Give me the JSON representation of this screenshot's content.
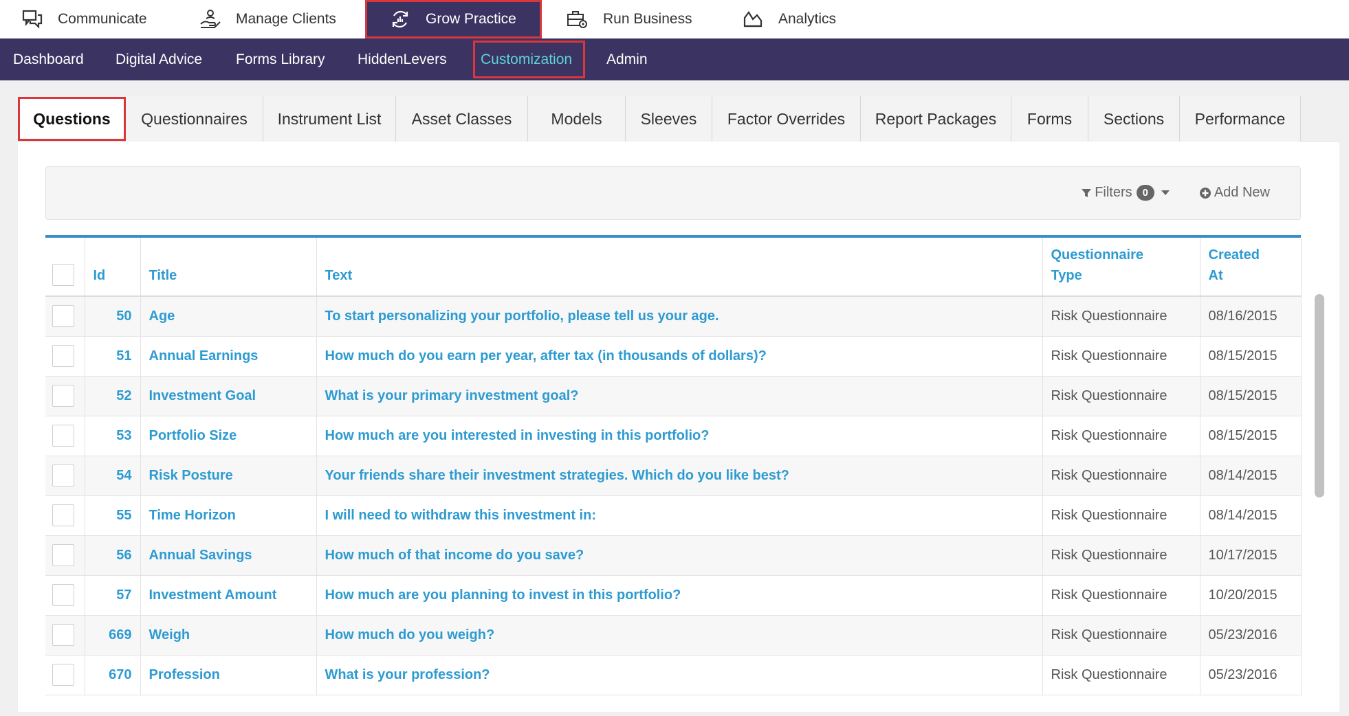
{
  "top_nav": [
    {
      "label": "Communicate",
      "icon": "chat-icon"
    },
    {
      "label": "Manage Clients",
      "icon": "hand-coins-icon"
    },
    {
      "label": "Grow Practice",
      "icon": "growth-cycle-icon",
      "active": true
    },
    {
      "label": "Run Business",
      "icon": "briefcase-gear-icon"
    },
    {
      "label": "Analytics",
      "icon": "area-chart-icon"
    }
  ],
  "sub_nav": [
    {
      "label": "Dashboard"
    },
    {
      "label": "Digital Advice"
    },
    {
      "label": "Forms Library"
    },
    {
      "label": "HiddenLevers"
    },
    {
      "label": "Customization",
      "active": true
    },
    {
      "label": "Admin"
    }
  ],
  "tabs": [
    {
      "label": "Questions",
      "active": true
    },
    {
      "label": "Questionnaires"
    },
    {
      "label": "Instrument List"
    },
    {
      "label": "Asset Classes"
    },
    {
      "label": "Models"
    },
    {
      "label": "Sleeves"
    },
    {
      "label": "Factor Overrides"
    },
    {
      "label": "Report Packages"
    },
    {
      "label": "Forms"
    },
    {
      "label": "Sections"
    },
    {
      "label": "Performance"
    }
  ],
  "toolbar": {
    "filters_label": "Filters",
    "filters_count": "0",
    "add_new_label": "Add New"
  },
  "table": {
    "columns": {
      "id": "Id",
      "title": "Title",
      "text": "Text",
      "qtype_line1": "Questionnaire",
      "qtype_line2": "Type",
      "created_line1": "Created",
      "created_line2": "At"
    },
    "rows": [
      {
        "id": "50",
        "title": "Age",
        "text": "To start personalizing your portfolio, please tell us your age.",
        "qtype": "Risk Questionnaire",
        "created": "08/16/2015"
      },
      {
        "id": "51",
        "title": "Annual Earnings",
        "text": "How much do you earn per year, after tax (in thousands of dollars)?",
        "qtype": "Risk Questionnaire",
        "created": "08/15/2015"
      },
      {
        "id": "52",
        "title": "Investment Goal",
        "text": "What is your primary investment goal?",
        "qtype": "Risk Questionnaire",
        "created": "08/15/2015"
      },
      {
        "id": "53",
        "title": "Portfolio Size",
        "text": "How much are you interested in investing in this portfolio?",
        "qtype": "Risk Questionnaire",
        "created": "08/15/2015"
      },
      {
        "id": "54",
        "title": "Risk Posture",
        "text": "Your friends share their investment strategies. Which do you like best?",
        "qtype": "Risk Questionnaire",
        "created": "08/14/2015"
      },
      {
        "id": "55",
        "title": "Time Horizon",
        "text": "I will need to withdraw this investment in:",
        "qtype": "Risk Questionnaire",
        "created": "08/14/2015"
      },
      {
        "id": "56",
        "title": "Annual Savings",
        "text": "How much of that income do you save?",
        "qtype": "Risk Questionnaire",
        "created": "10/17/2015"
      },
      {
        "id": "57",
        "title": "Investment Amount",
        "text": "How much are you planning to invest in this portfolio?",
        "qtype": "Risk Questionnaire",
        "created": "10/20/2015"
      },
      {
        "id": "669",
        "title": "Weigh",
        "text": "How much do you weigh?",
        "qtype": "Risk Questionnaire",
        "created": "05/23/2016"
      },
      {
        "id": "670",
        "title": "Profession",
        "text": "What is your profession?",
        "qtype": "Risk Questionnaire",
        "created": "05/23/2016"
      }
    ]
  },
  "colors": {
    "nav_bg": "#3b3462",
    "active_sub": "#5ed3d4",
    "highlight": "#d9373b",
    "link": "#2d9bd2",
    "table_top": "#3a8fc7"
  }
}
